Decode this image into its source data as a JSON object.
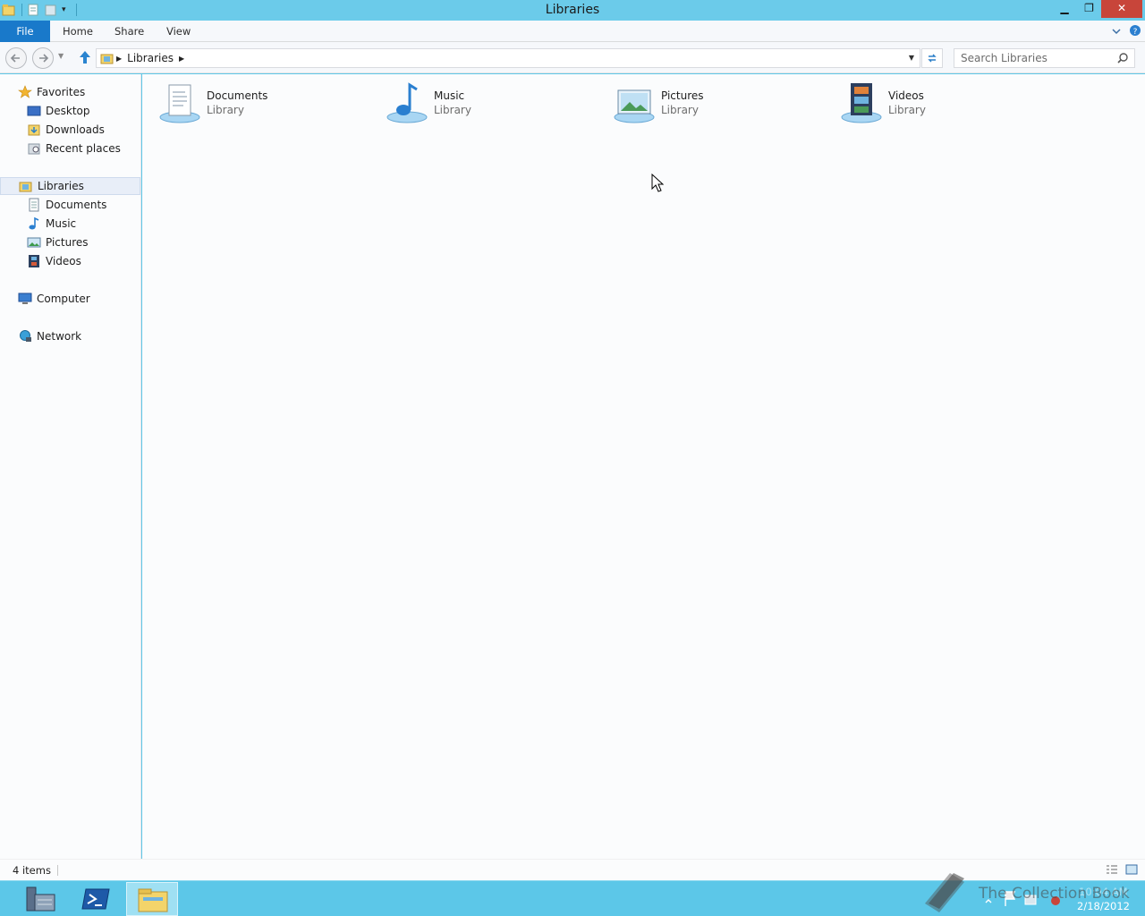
{
  "window": {
    "title": "Libraries",
    "controls": {
      "minimize": "▁",
      "maximize": "❐",
      "close": "✕"
    }
  },
  "ribbon": {
    "tabs": [
      "File",
      "Home",
      "Share",
      "View"
    ]
  },
  "address": {
    "crumbs": [
      "Libraries"
    ],
    "search_placeholder": "Search Libraries"
  },
  "nav": {
    "favorites": {
      "label": "Favorites",
      "items": [
        "Desktop",
        "Downloads",
        "Recent places"
      ]
    },
    "libraries": {
      "label": "Libraries",
      "items": [
        "Documents",
        "Music",
        "Pictures",
        "Videos"
      ]
    },
    "computer": "Computer",
    "network": "Network"
  },
  "content": {
    "items": [
      {
        "name": "Documents",
        "type": "Library",
        "icon": "documents-library-icon"
      },
      {
        "name": "Music",
        "type": "Library",
        "icon": "music-library-icon"
      },
      {
        "name": "Pictures",
        "type": "Library",
        "icon": "pictures-library-icon"
      },
      {
        "name": "Videos",
        "type": "Library",
        "icon": "videos-library-icon"
      }
    ]
  },
  "status": {
    "count": "4 items"
  },
  "taskbar": {
    "date": "2/18/2012",
    "time": "10:04 AM"
  },
  "watermark": "The Collection Book",
  "colors": {
    "titlebar": "#6bcbea",
    "file_tab": "#1979ca",
    "taskbar": "#5cc7e8",
    "close": "#c8453a"
  }
}
